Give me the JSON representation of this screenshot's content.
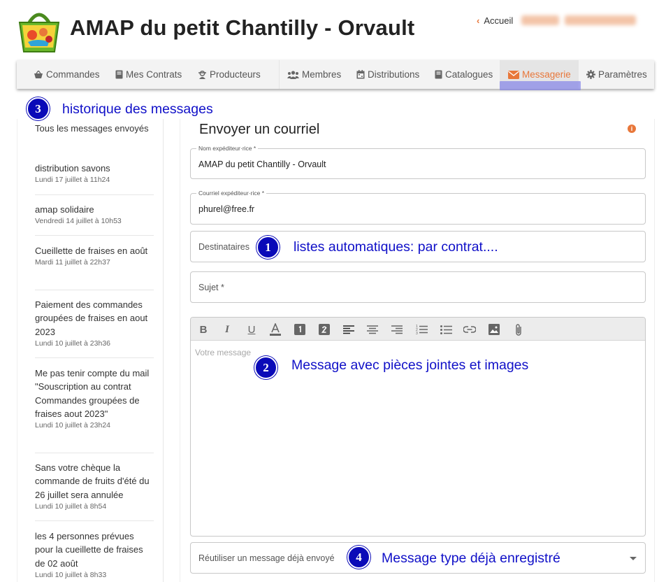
{
  "header": {
    "site_title": "AMAP du petit Chantilly - Orvault",
    "home_link": "Accueil",
    "user_blurred_1": "Admin",
    "user_blurred_2": "HUREL Fabrice"
  },
  "nav": {
    "items": [
      {
        "label": "Commandes",
        "icon": "basket-icon"
      },
      {
        "label": "Mes Contrats",
        "icon": "book-icon"
      },
      {
        "label": "Producteurs",
        "icon": "farmer-icon"
      },
      {
        "label": "Membres",
        "icon": "users-icon"
      },
      {
        "label": "Distributions",
        "icon": "calendar-icon"
      },
      {
        "label": "Catalogues",
        "icon": "book-icon"
      },
      {
        "label": "Messagerie",
        "icon": "envelope-icon",
        "active": true
      },
      {
        "label": "Paramètres",
        "icon": "gear-icon"
      }
    ],
    "accent_color": "#e8773a"
  },
  "annotations": {
    "a1": {
      "number": "1",
      "text": "listes automatiques: par contrat...."
    },
    "a2": {
      "number": "2",
      "text": "Message avec pièces jointes et images"
    },
    "a3": {
      "number": "3",
      "text": "historique des messages"
    },
    "a4": {
      "number": "4",
      "text": "Message type déjà enregistré"
    }
  },
  "sidebar": {
    "header": "Tous les messages envoyés",
    "messages": [
      {
        "title": "distribution savons",
        "date": "Lundi 17 juillet à 11h24"
      },
      {
        "title": "amap solidaire",
        "date": "Vendredi 14 juillet à 10h53"
      },
      {
        "title": "Cueillette de fraises en août",
        "date": "Mardi 11 juillet à 22h37"
      },
      {
        "title": "Paiement des commandes groupées de fraises en aout 2023",
        "date": "Lundi 10 juillet à 23h36"
      },
      {
        "title": "Me pas tenir compte du mail \"Souscription au contrat Commandes groupées de fraises aout 2023\"",
        "date": "Lundi 10 juillet à 23h24"
      },
      {
        "title": "Sans votre chèque la commande de fruits d'été du 26 juillet sera annulée",
        "date": "Lundi 10 juillet à 8h54"
      },
      {
        "title": "les 4 personnes prévues pour la cueillette de fraises de 02 août",
        "date": "Lundi 10 juillet à 8h33"
      }
    ]
  },
  "form": {
    "title": "Envoyer un courriel",
    "sender_name_label": "Nom expéditeur·rice *",
    "sender_name_value": "AMAP du petit Chantilly - Orvault",
    "sender_email_label": "Courriel expéditeur·rice *",
    "sender_email_value": "phurel@free.fr",
    "recipients_placeholder": "Destinataires",
    "subject_placeholder": "Sujet *",
    "message_placeholder": "Votre message",
    "reuse_placeholder": "Réutiliser un message déjà envoyé"
  },
  "toolbar": [
    "bold-icon",
    "italic-icon",
    "underline-icon",
    "text-color-icon",
    "heading-1-icon",
    "heading-2-icon",
    "align-left-icon",
    "align-center-icon",
    "align-right-icon",
    "ordered-list-icon",
    "bullet-list-icon",
    "link-icon",
    "image-icon",
    "attachment-icon"
  ]
}
